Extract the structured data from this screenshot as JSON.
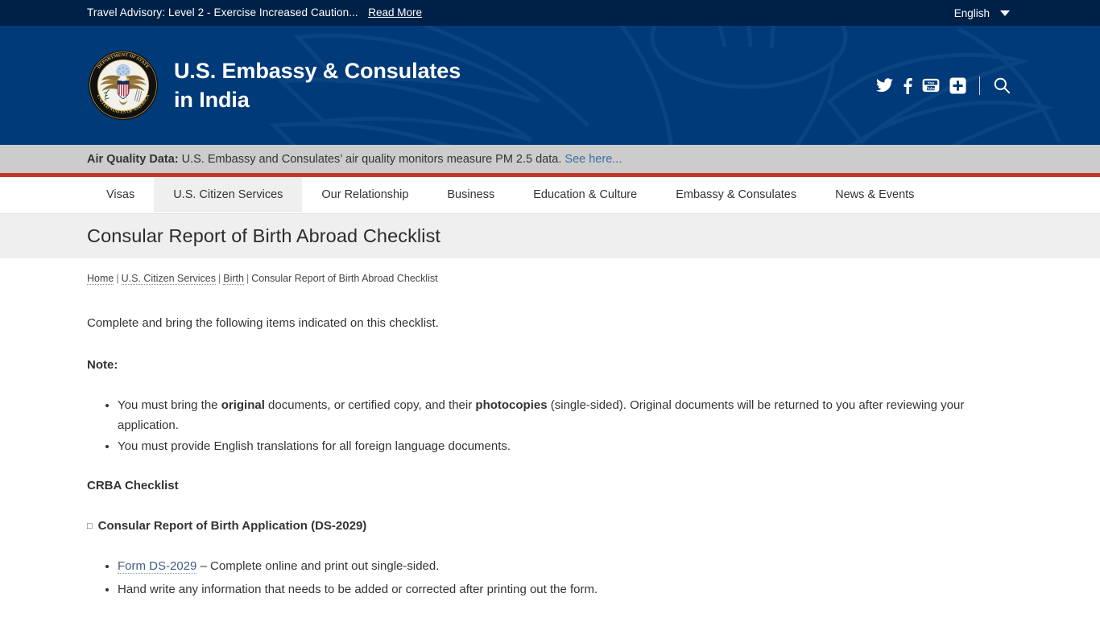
{
  "advisory": {
    "text": "Travel Advisory: Level 2 - Exercise Increased Caution...",
    "link_label": "Read More",
    "language": "English",
    "caret_icon": "chevron-down-icon"
  },
  "header": {
    "seal_icon": "department-of-state-seal",
    "brand_line1": "U.S. Embassy & Consulates",
    "brand_line2": "in India",
    "social": [
      {
        "name": "twitter-icon",
        "label": "Twitter"
      },
      {
        "name": "facebook-icon",
        "label": "Facebook"
      },
      {
        "name": "youtube-icon",
        "label": "YouTube"
      },
      {
        "name": "share-plus-icon",
        "label": "Share"
      }
    ],
    "search_icon": "search-icon",
    "background": "#003a78"
  },
  "air_quality": {
    "label": "Air Quality Data:",
    "text": " U.S. Embassy and Consulates’ air quality monitors measure PM 2.5 data. ",
    "link_label": "See here...",
    "bar_color": "#cccccc",
    "rule_color": "#c0392b"
  },
  "nav": {
    "items": [
      {
        "label": "Visas",
        "active": false
      },
      {
        "label": "U.S. Citizen Services",
        "active": true
      },
      {
        "label": "Our Relationship",
        "active": false
      },
      {
        "label": "Business",
        "active": false
      },
      {
        "label": "Education & Culture",
        "active": false
      },
      {
        "label": "Embassy & Consulates",
        "active": false
      },
      {
        "label": "News & Events",
        "active": false
      }
    ]
  },
  "page": {
    "title": "Consular Report of Birth Abroad Checklist",
    "breadcrumb": {
      "items": [
        {
          "label": "Home",
          "link": true
        },
        {
          "label": "U.S. Citizen Services",
          "link": true
        },
        {
          "label": "Birth",
          "link": true
        },
        {
          "label": "Consular Report of Birth Abroad Checklist",
          "link": false
        }
      ],
      "separator": "|"
    }
  },
  "content": {
    "intro": "Complete and bring the following items indicated on this checklist.",
    "note_heading": "Note:",
    "note_items": [
      {
        "part1": "You must bring the ",
        "bold1": "original",
        "part2": " documents, or certified copy, and their ",
        "bold2": "photocopies",
        "part3": " (single-sided). Original documents will be returned to you after reviewing your application."
      },
      {
        "plain": "You must provide English translations for all foreign language documents."
      }
    ],
    "checklist_heading": "CRBA Checklist",
    "section": {
      "box_glyph": "□",
      "heading": "Consular Report of Birth Application (DS-2029)",
      "items": [
        {
          "link_label": "Form DS-2029",
          "rest": " – Complete online and print out single-sided."
        },
        {
          "plain": "Hand write any information that needs to be added or corrected after printing out the form."
        }
      ]
    }
  }
}
